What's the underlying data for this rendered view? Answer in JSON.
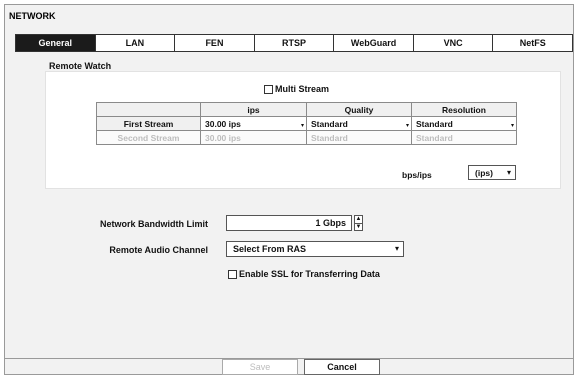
{
  "window": {
    "title": "NETWORK"
  },
  "tabs": [
    {
      "label": "General",
      "active": true
    },
    {
      "label": "LAN"
    },
    {
      "label": "FEN"
    },
    {
      "label": "RTSP"
    },
    {
      "label": "WebGuard"
    },
    {
      "label": "VNC"
    },
    {
      "label": "NetFS"
    }
  ],
  "remote_watch": {
    "section_label": "Remote Watch",
    "multi_stream_label": "Multi Stream",
    "multi_stream_checked": false,
    "columns": [
      "ips",
      "Quality",
      "Resolution"
    ],
    "rows": [
      {
        "name": "First Stream",
        "ips": "30.00 ips",
        "quality": "Standard",
        "resolution": "Standard",
        "enabled": true
      },
      {
        "name": "Second Stream",
        "ips": "30.00 ips",
        "quality": "Standard",
        "resolution": "Standard",
        "enabled": false
      }
    ],
    "bps_label": "bps/ips",
    "bps_value": "(ips)"
  },
  "settings": {
    "bandwidth_label": "Network Bandwidth Limit",
    "bandwidth_value": "1 Gbps",
    "audio_label": "Remote Audio Channel",
    "audio_value": "Select From RAS",
    "ssl_label": "Enable SSL for Transferring Data",
    "ssl_checked": false
  },
  "buttons": {
    "save": "Save",
    "cancel": "Cancel"
  },
  "icons": {
    "spinner": "spinner-arrows-icon",
    "dropdown": "chevron-down-icon",
    "checkbox": "checkbox-icon"
  },
  "colors": {
    "active_tab_bg": "#1b1b1b",
    "disabled_text": "#bdbdbd",
    "panel_bg": "#ffffff",
    "window_bg": "#f2f2f2"
  }
}
